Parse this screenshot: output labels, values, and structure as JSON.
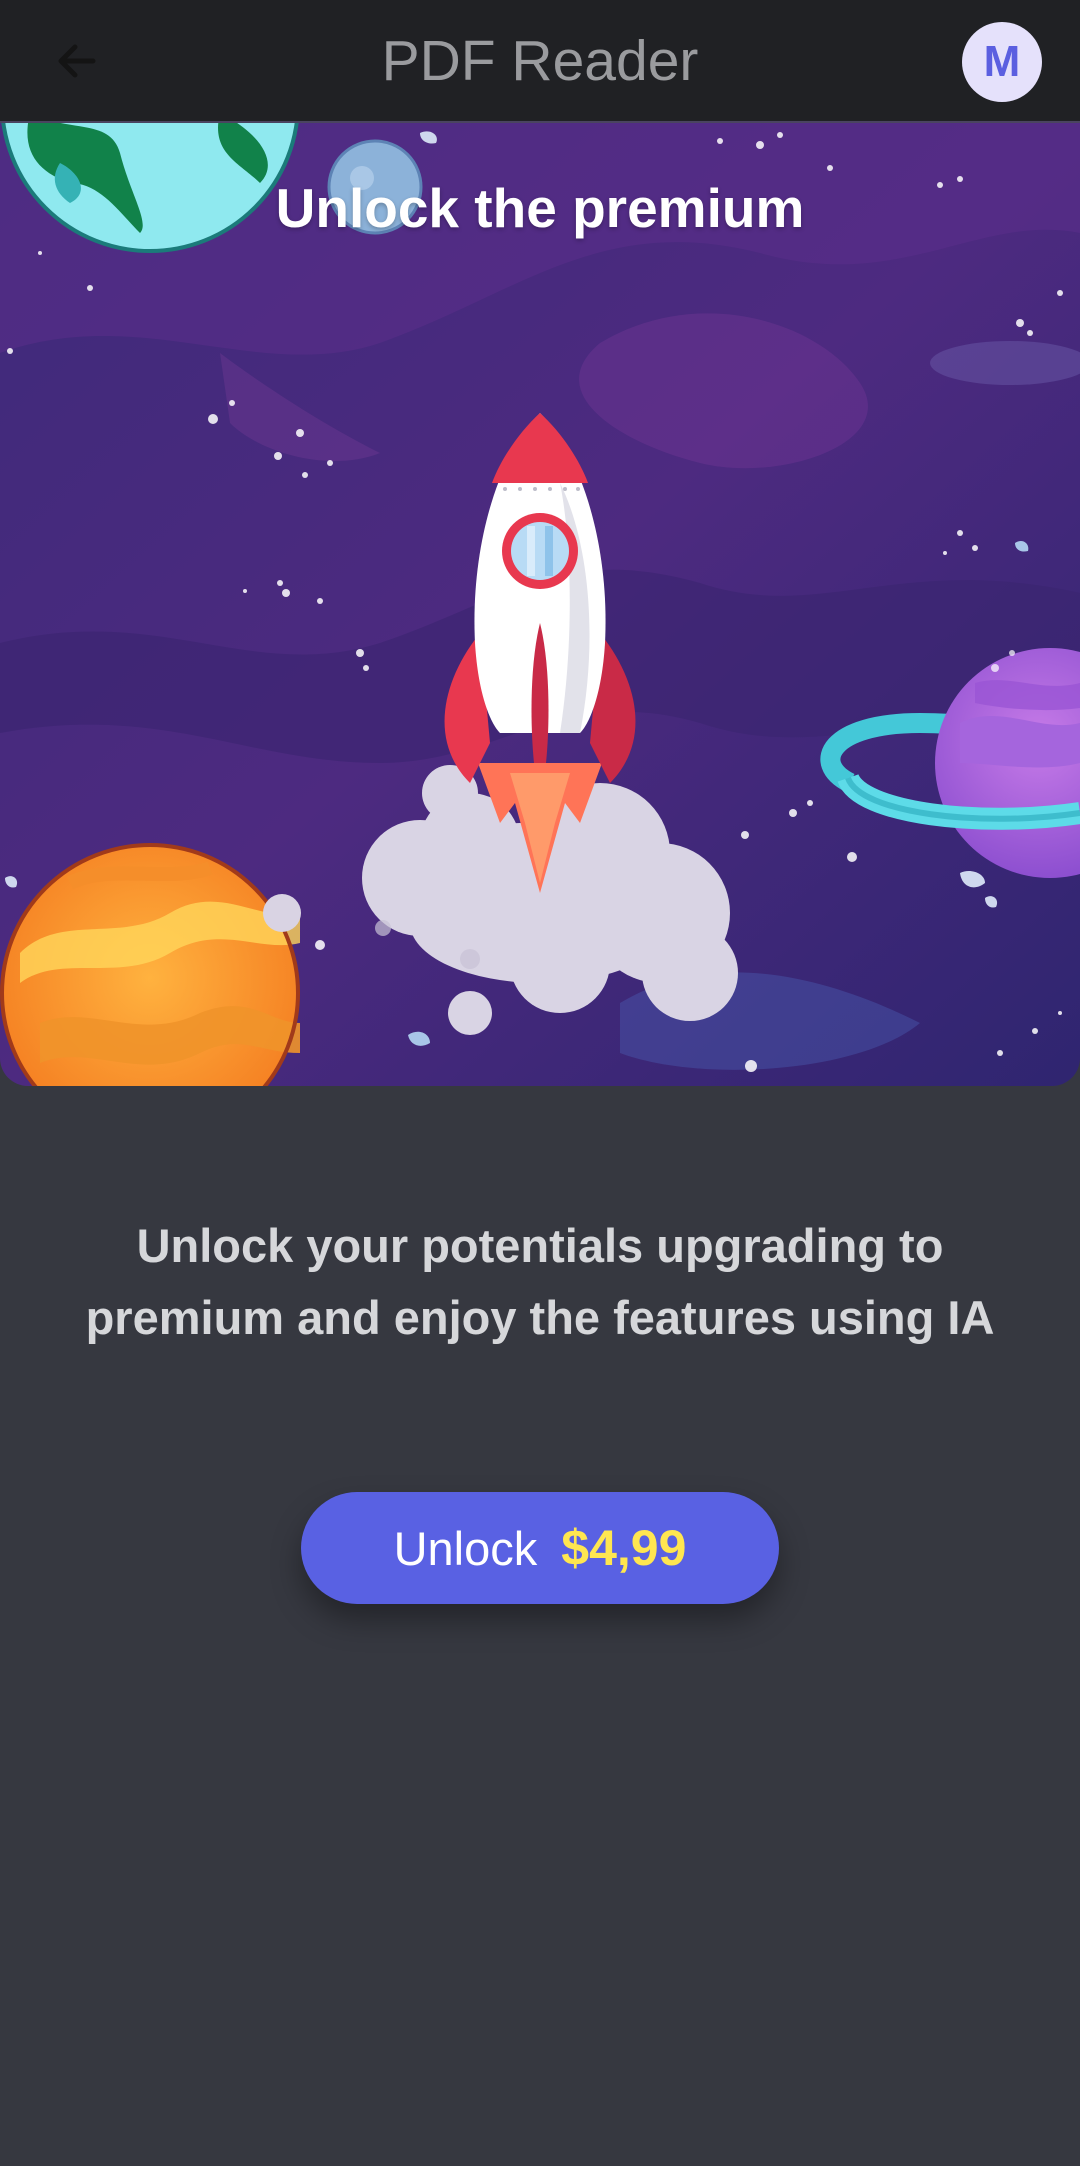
{
  "app_bar": {
    "title": "PDF Reader",
    "back_icon": "arrow-left-icon",
    "avatar_initial": "M"
  },
  "hero": {
    "title": "Unlock the premium",
    "illustration": "rocket-launch-space-illustration"
  },
  "description": "Unlock your potentials upgrading to premium and enjoy the features using IA",
  "unlock_button": {
    "label": "Unlock",
    "price": "$4,99"
  },
  "colors": {
    "app_bar_bg": "#202124",
    "page_bg": "#363840",
    "button_bg": "#5961e3",
    "price_color": "#ffe650",
    "avatar_bg": "#e5e1fb",
    "avatar_fg": "#5b5fe0"
  }
}
